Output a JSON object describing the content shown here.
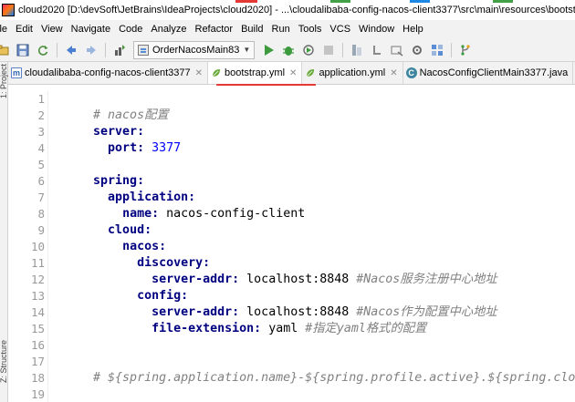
{
  "window": {
    "title": "cloud2020 [D:\\devSoft\\JetBrains\\IdeaProjects\\cloud2020] - ...\\cloudalibaba-config-nacos-client3377\\src\\main\\resources\\bootstrap.yml",
    "accent_colors": [
      "#e53935",
      "#43a047",
      "#1e88e5",
      "#43a047"
    ]
  },
  "menu": {
    "items": [
      "ile",
      "Edit",
      "View",
      "Navigate",
      "Code",
      "Analyze",
      "Refactor",
      "Build",
      "Run",
      "Tools",
      "VCS",
      "Window",
      "Help"
    ]
  },
  "toolbar": {
    "icons": [
      "save-icon",
      "sync-icon",
      "back-icon",
      "forward-icon",
      "build-icon"
    ],
    "run_config": "OrderNacosMain83",
    "actions": [
      "run-icon",
      "debug-icon",
      "coverage-icon",
      "stop-icon",
      "structure-icon",
      "sdk-icon",
      "search-icon",
      "project-structure-icon",
      "vcs-icon"
    ]
  },
  "left_strip": {
    "top_label": "1: Project",
    "bottom_label": "Z: Structure"
  },
  "tabs": [
    {
      "label": "cloudalibaba-config-nacos-client3377",
      "icon": "module-icon",
      "active": false
    },
    {
      "label": "bootstrap.yml",
      "icon": "spring-leaf-icon",
      "active": true
    },
    {
      "label": "application.yml",
      "icon": "spring-leaf-icon",
      "active": false
    },
    {
      "label": "NacosConfigClientMain3377.java",
      "icon": "class-icon",
      "active": false
    }
  ],
  "editor": {
    "lines": [
      {
        "n": "1",
        "indent": "",
        "key": "",
        "value": "",
        "comment": "# nacos配置"
      },
      {
        "n": "2",
        "indent": "",
        "key": "server:",
        "value": "",
        "comment": ""
      },
      {
        "n": "3",
        "indent": "  ",
        "key": "port:",
        "value": "3377",
        "comment": "",
        "numeric": true
      },
      {
        "n": "4",
        "indent": "",
        "key": "",
        "value": "",
        "comment": ""
      },
      {
        "n": "5",
        "indent": "",
        "key": "spring:",
        "value": "",
        "comment": ""
      },
      {
        "n": "6",
        "indent": "  ",
        "key": "application:",
        "value": "",
        "comment": ""
      },
      {
        "n": "7",
        "indent": "    ",
        "key": "name:",
        "value": "nacos-config-client",
        "comment": ""
      },
      {
        "n": "8",
        "indent": "  ",
        "key": "cloud:",
        "value": "",
        "comment": ""
      },
      {
        "n": "9",
        "indent": "    ",
        "key": "nacos:",
        "value": "",
        "comment": ""
      },
      {
        "n": "10",
        "indent": "      ",
        "key": "discovery:",
        "value": "",
        "comment": ""
      },
      {
        "n": "11",
        "indent": "        ",
        "key": "server-addr:",
        "value": "localhost:8848",
        "comment": "#Nacos服务注册中心地址"
      },
      {
        "n": "12",
        "indent": "      ",
        "key": "config:",
        "value": "",
        "comment": ""
      },
      {
        "n": "13",
        "indent": "        ",
        "key": "server-addr:",
        "value": "localhost:8848",
        "comment": "#Nacos作为配置中心地址"
      },
      {
        "n": "14",
        "indent": "        ",
        "key": "file-extension:",
        "value": "yaml",
        "comment": "#指定yaml格式的配置"
      },
      {
        "n": "15",
        "indent": "",
        "key": "",
        "value": "",
        "comment": ""
      },
      {
        "n": "16",
        "indent": "",
        "key": "",
        "value": "",
        "comment": ""
      },
      {
        "n": "17",
        "indent": "",
        "key": "",
        "value": "",
        "comment": "# ${spring.application.name}-${spring.profile.active}.${spring.cloud.nacos.config.file-extension}"
      },
      {
        "n": "18",
        "indent": "",
        "key": "",
        "value": "",
        "comment": ""
      },
      {
        "n": "19",
        "indent": "",
        "key": "",
        "value": "",
        "comment": ""
      }
    ]
  }
}
